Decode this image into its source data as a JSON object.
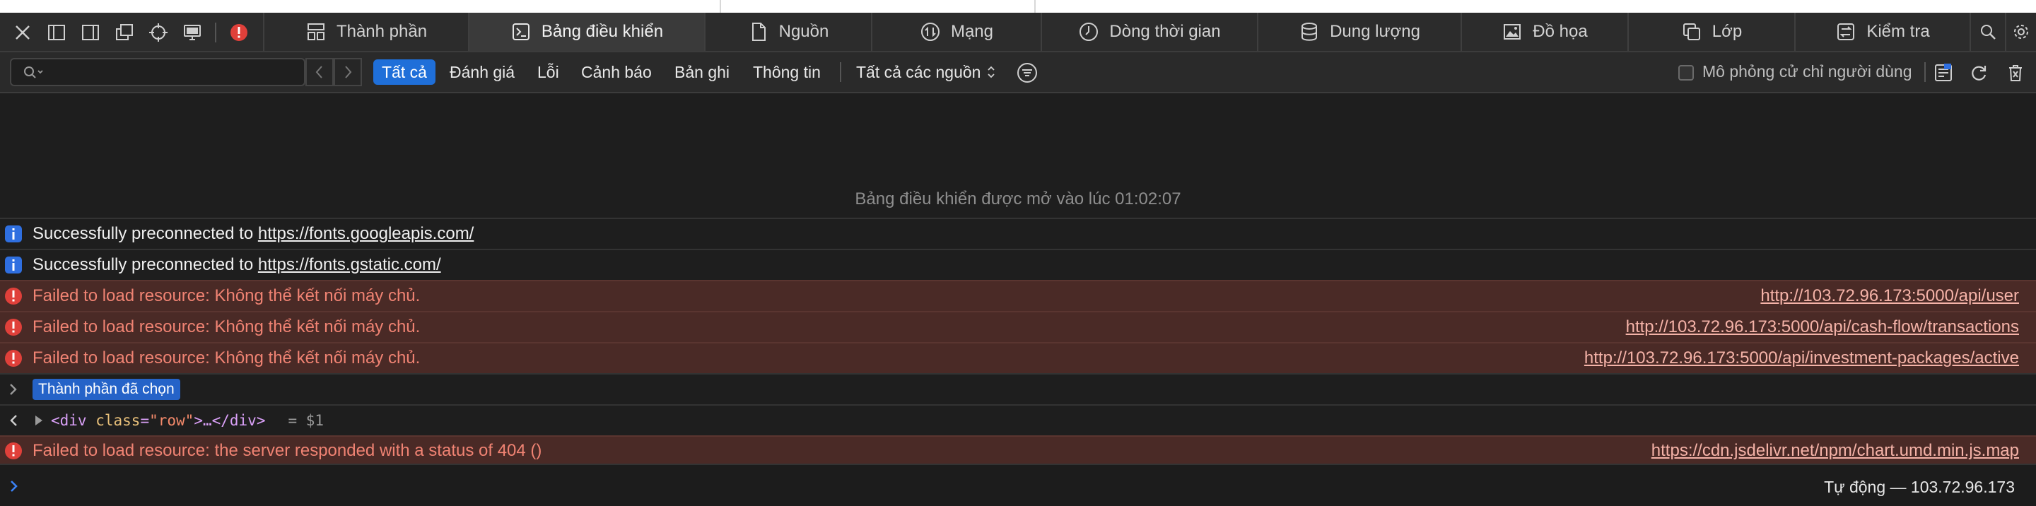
{
  "toolbar": {
    "icons": [
      "close-icon",
      "dock-left-icon",
      "dock-right-icon",
      "undock-icon",
      "element-picker-icon",
      "device-icon",
      "error-badge-icon"
    ]
  },
  "tabs": [
    {
      "label": "Thành phần",
      "icon": "elements-icon",
      "active": false
    },
    {
      "label": "Bảng điều khiển",
      "icon": "console-icon",
      "active": true
    },
    {
      "label": "Nguồn",
      "icon": "sources-icon",
      "active": false
    },
    {
      "label": "Mạng",
      "icon": "network-icon",
      "active": false
    },
    {
      "label": "Dòng thời gian",
      "icon": "timeline-icon",
      "active": false
    },
    {
      "label": "Dung lượng",
      "icon": "storage-icon",
      "active": false
    },
    {
      "label": "Đồ họa",
      "icon": "graphics-icon",
      "active": false
    },
    {
      "label": "Lớp",
      "icon": "layers-icon",
      "active": false
    },
    {
      "label": "Kiểm tra",
      "icon": "audit-icon",
      "active": false
    }
  ],
  "filter": {
    "search_placeholder": "",
    "levels": [
      "Tất cả",
      "Đánh giá",
      "Lỗi",
      "Cảnh báo",
      "Bản ghi",
      "Thông tin"
    ],
    "active_level": "Tất cả",
    "sources_select": "Tất cả các nguồn",
    "simulate_label": "Mô phỏng cử chỉ người dùng"
  },
  "console": {
    "opened_message": "Bảng điều khiển được mở vào lúc 01:02:07",
    "messages": [
      {
        "type": "info",
        "text": "Successfully preconnected to ",
        "link": "https://fonts.googleapis.com/",
        "source": ""
      },
      {
        "type": "info",
        "text": "Successfully preconnected to ",
        "link": "https://fonts.gstatic.com/",
        "source": ""
      },
      {
        "type": "error",
        "text": "Failed to load resource: Không thể kết nối máy chủ.",
        "link": "",
        "source": "http://103.72.96.173:5000/api/user"
      },
      {
        "type": "error",
        "text": "Failed to load resource: Không thể kết nối máy chủ.",
        "link": "",
        "source": "http://103.72.96.173:5000/api/cash-flow/transactions"
      },
      {
        "type": "error",
        "text": "Failed to load resource: Không thể kết nối máy chủ.",
        "link": "",
        "source": "http://103.72.96.173:5000/api/investment-packages/active"
      }
    ],
    "selected_badge": "Thành phần đã chọn",
    "result": {
      "open": "<div ",
      "attr_name": "class",
      "eq": "=",
      "attr_value": "\"row\"",
      "rest": ">…</div>",
      "ref": "= $1"
    },
    "error_404": {
      "text": "Failed to load resource: the server responded with a status of 404 ()",
      "source": "https://cdn.jsdelivr.net/npm/chart.umd.min.js.map"
    },
    "context": "Tự động — 103.72.96.173"
  },
  "colors": {
    "accent": "#1f6fd9",
    "error_bg": "#4a2a26",
    "error_text": "#f08373",
    "info_icon": "#2f6fe0",
    "error_icon": "#e0403a"
  }
}
